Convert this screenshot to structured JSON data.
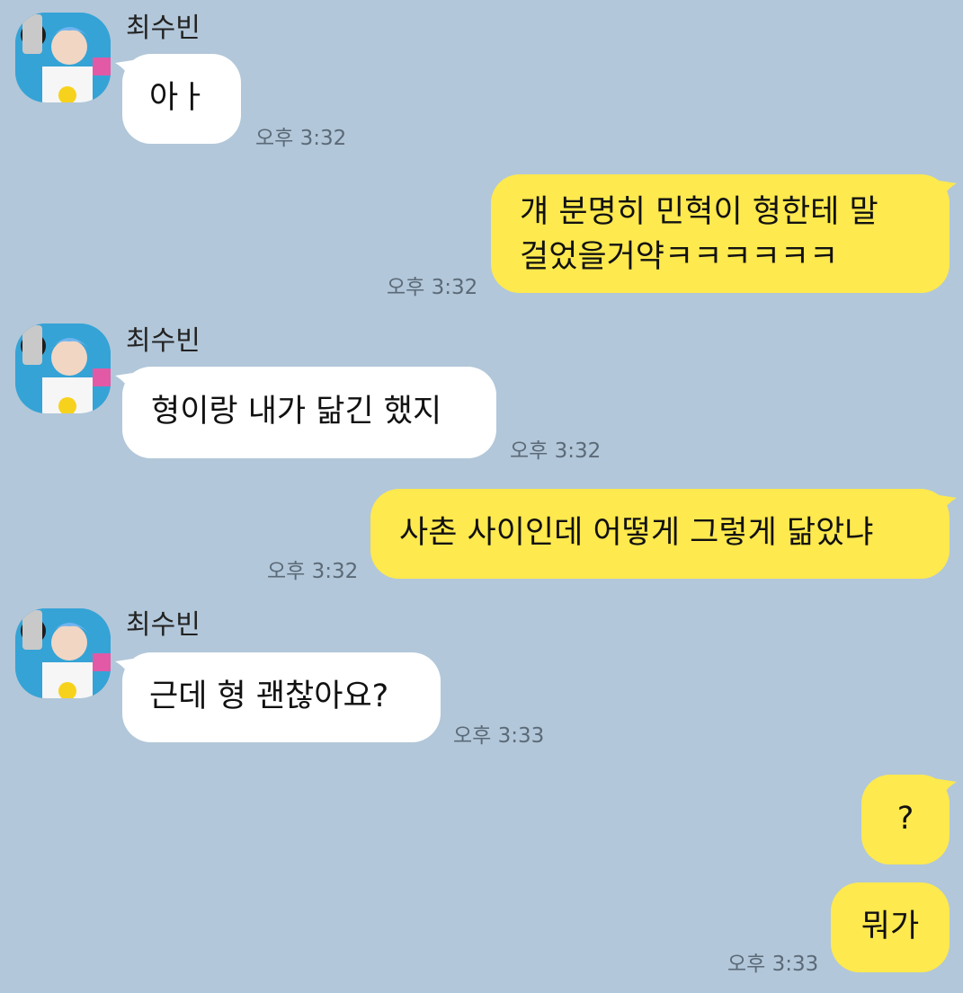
{
  "sender_name": "최수빈",
  "messages": [
    {
      "from": "them",
      "text": "아ㅏ",
      "time": "오후 3:32"
    },
    {
      "from": "me",
      "lines": [
        "걔 분명히 민혁이 형한테 말",
        "걸었을거약ㅋㅋㅋㅋㅋㅋ"
      ],
      "time": "오후 3:32"
    },
    {
      "from": "them",
      "text": "형이랑 내가 닮긴 했지",
      "time": "오후 3:32"
    },
    {
      "from": "me",
      "text": "사촌 사이인데 어떻게 그렇게 닮았냐",
      "time": "오후 3:32"
    },
    {
      "from": "them",
      "text": "근데 형 괜찮아요?",
      "time": "오후 3:33"
    },
    {
      "from": "me",
      "text": "?",
      "time": ""
    },
    {
      "from": "me",
      "text": "뭐가",
      "time": "오후 3:33"
    }
  ],
  "colors": {
    "background": "#b2c7d9",
    "incoming_bubble": "#ffffff",
    "outgoing_bubble": "#fee94e"
  }
}
